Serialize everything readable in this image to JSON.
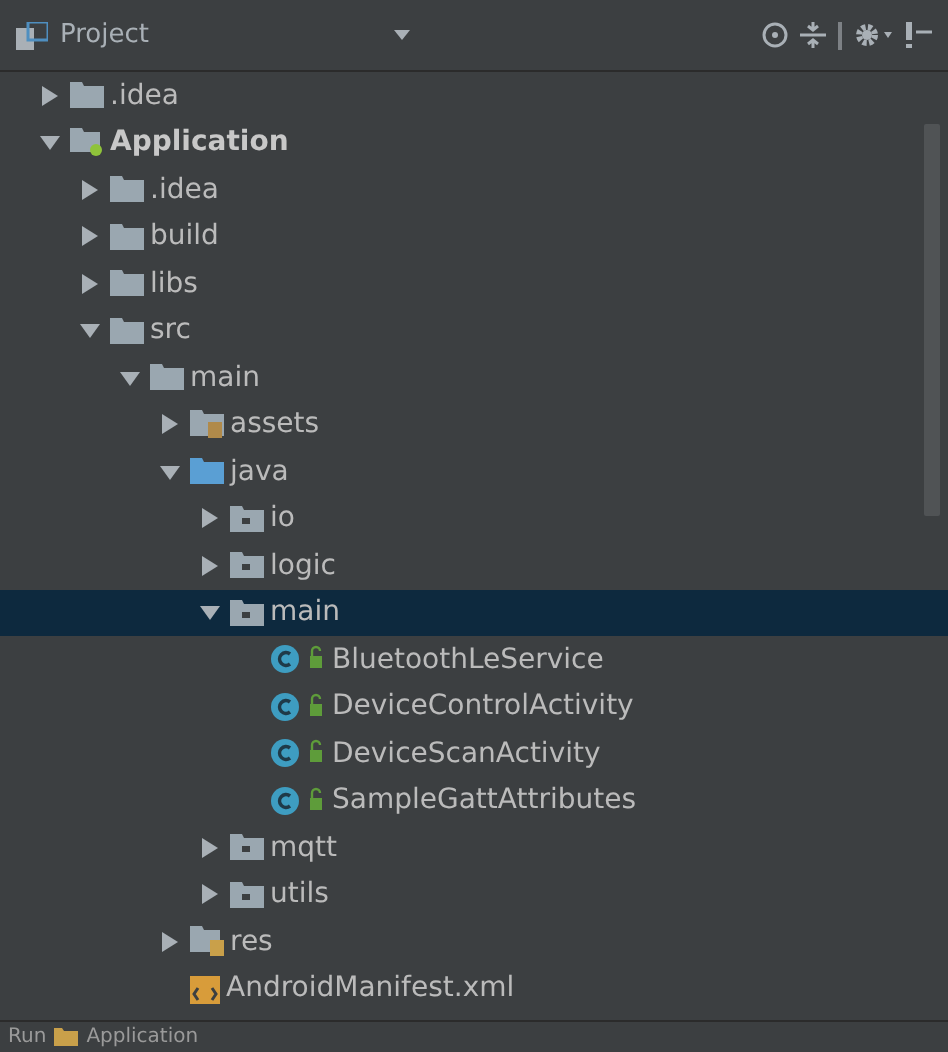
{
  "panel": {
    "title": "Project"
  },
  "tree": [
    {
      "label": ".idea",
      "kind": "folder",
      "expanded": false,
      "selected": false
    },
    {
      "label": "Application",
      "kind": "module",
      "expanded": true,
      "selected": false,
      "children": [
        {
          "label": ".idea",
          "kind": "folder",
          "expanded": false,
          "selected": false
        },
        {
          "label": "build",
          "kind": "folder",
          "expanded": false,
          "selected": false
        },
        {
          "label": "libs",
          "kind": "folder",
          "expanded": false,
          "selected": false
        },
        {
          "label": "src",
          "kind": "folder",
          "expanded": true,
          "selected": false,
          "children": [
            {
              "label": "main",
              "kind": "folder",
              "expanded": true,
              "selected": false,
              "children": [
                {
                  "label": "assets",
                  "kind": "assets",
                  "expanded": false,
                  "selected": false
                },
                {
                  "label": "java",
                  "kind": "source",
                  "expanded": true,
                  "selected": false,
                  "children": [
                    {
                      "label": "io",
                      "kind": "package",
                      "expanded": false,
                      "selected": false
                    },
                    {
                      "label": "logic",
                      "kind": "package",
                      "expanded": false,
                      "selected": false
                    },
                    {
                      "label": "main",
                      "kind": "package",
                      "expanded": true,
                      "selected": true,
                      "children": [
                        {
                          "label": "BluetoothLeService",
                          "kind": "class",
                          "selected": false
                        },
                        {
                          "label": "DeviceControlActivity",
                          "kind": "class",
                          "selected": false
                        },
                        {
                          "label": "DeviceScanActivity",
                          "kind": "class",
                          "selected": false
                        },
                        {
                          "label": "SampleGattAttributes",
                          "kind": "class",
                          "selected": false
                        }
                      ]
                    },
                    {
                      "label": "mqtt",
                      "kind": "package",
                      "expanded": false,
                      "selected": false
                    },
                    {
                      "label": "utils",
                      "kind": "package",
                      "expanded": false,
                      "selected": false
                    }
                  ]
                },
                {
                  "label": "res",
                  "kind": "resources",
                  "expanded": false,
                  "selected": false
                },
                {
                  "label": "AndroidManifest.xml",
                  "kind": "manifest",
                  "selected": false
                }
              ]
            }
          ]
        }
      ]
    }
  ],
  "bottom_bar": {
    "tool": "Run",
    "config": "Application"
  }
}
